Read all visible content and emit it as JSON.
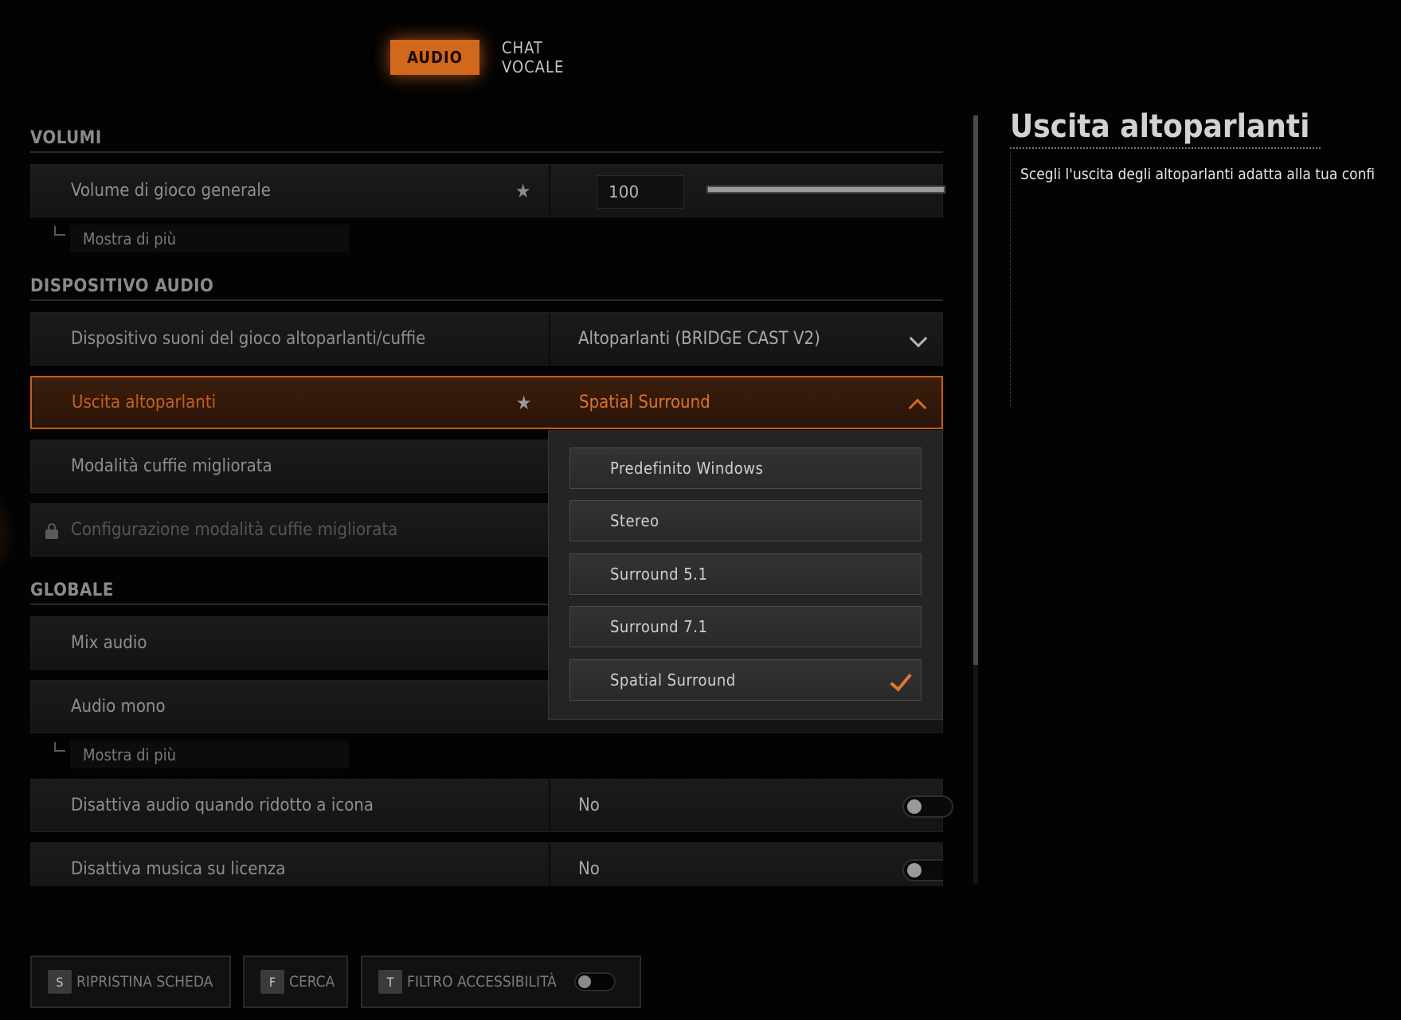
{
  "tabs": [
    {
      "label": "AUDIO",
      "active": true
    },
    {
      "label": "CHAT VOCALE",
      "active": false
    }
  ],
  "sections": {
    "volumi": "VOLUMI",
    "dispositivo": "DISPOSITIVO AUDIO",
    "globale": "GLOBALE"
  },
  "settings": {
    "volume": {
      "label": "Volume di gioco generale",
      "value": "100",
      "slider_fraction": 1.0
    },
    "device": {
      "label": "Dispositivo suoni del gioco altoparlanti/cuffie",
      "value": "Altoparlanti (BRIDGE CAST V2)"
    },
    "speaker_output": {
      "label": "Uscita altoparlanti",
      "value": "Spatial Surround"
    },
    "headphone_mode": {
      "label": "Modalità cuffie migliorata"
    },
    "headphone_config": {
      "label": "Configurazione modalità cuffie migliorata"
    },
    "mix": {
      "label": "Mix audio"
    },
    "mono": {
      "label": "Audio mono"
    },
    "mute_minimized": {
      "label": "Disattiva audio quando ridotto a icona",
      "value": "No"
    },
    "mute_music": {
      "label": "Disattiva musica su licenza",
      "value": "No"
    }
  },
  "show_more": "Mostra di più",
  "dropdown_options": [
    "Predefinito Windows",
    "Stereo",
    "Surround 5.1",
    "Surround 7.1",
    "Spatial Surround"
  ],
  "dropdown_selected": "Spatial Surround",
  "info": {
    "title": "Uscita altoparlanti",
    "text": "Scegli l'uscita degli altoparlanti adatta alla tua confi"
  },
  "footer": {
    "reset": {
      "key": "S",
      "label": "RIPRISTINA SCHEDA"
    },
    "search": {
      "key": "F",
      "label": "CERCA"
    },
    "accessibility": {
      "key": "T",
      "label": "FILTRO ACCESSIBILITÀ"
    }
  },
  "colors": {
    "accent": "#d2681b",
    "background": "#030303"
  }
}
